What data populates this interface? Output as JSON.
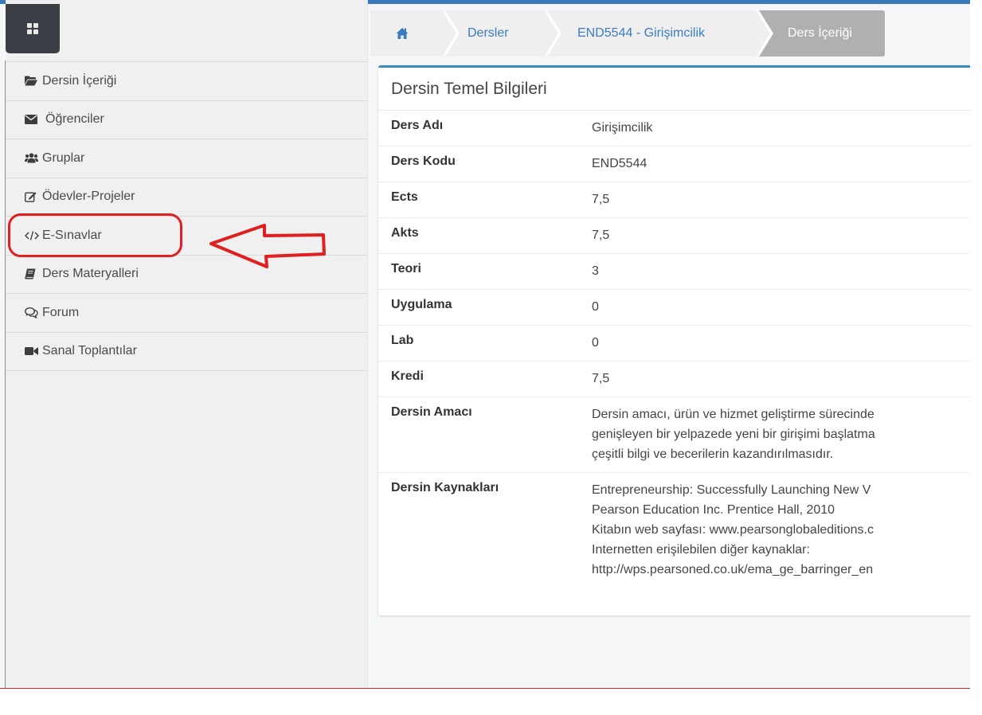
{
  "sidebar": {
    "items": [
      {
        "icon": "folder-open-icon",
        "label": "Dersin İçeriği"
      },
      {
        "icon": "envelope-icon",
        "label": "Öğrenciler"
      },
      {
        "icon": "users-icon",
        "label": "Gruplar"
      },
      {
        "icon": "edit-icon",
        "label": "Ödevler-Projeler"
      },
      {
        "icon": "code-icon",
        "label": "E-Sınavlar"
      },
      {
        "icon": "book-icon",
        "label": "Ders Materyalleri"
      },
      {
        "icon": "comments-icon",
        "label": "Forum"
      },
      {
        "icon": "video-camera-icon",
        "label": "Sanal Toplantılar"
      }
    ]
  },
  "breadcrumb": {
    "home_icon": "home-icon",
    "items": [
      "Dersler",
      "END5544 - Girişimcilik",
      "Ders İçeriği"
    ]
  },
  "panel": {
    "title": "Dersin Temel Bilgileri",
    "rows": [
      {
        "label": "Ders Adı",
        "value": "Girişimcilik"
      },
      {
        "label": "Ders Kodu",
        "value": "END5544"
      },
      {
        "label": "Ects",
        "value": "7,5"
      },
      {
        "label": "Akts",
        "value": "7,5"
      },
      {
        "label": "Teori",
        "value": "3"
      },
      {
        "label": "Uygulama",
        "value": "0"
      },
      {
        "label": "Lab",
        "value": "0"
      },
      {
        "label": "Kredi",
        "value": "7,5"
      }
    ],
    "amac": {
      "label": "Dersin Amacı",
      "lines": [
        "Dersin amacı, ürün ve hizmet geliştirme sürecinde",
        "genişleyen bir yelpazede yeni bir girişimi başlatma",
        "çeşitli bilgi ve becerilerin kazandırılmasıdır."
      ]
    },
    "kaynaklar": {
      "label": "Dersin Kaynakları",
      "lines": [
        "Entrepreneurship: Successfully Launching New V",
        "Pearson Education Inc. Prentice Hall, 2010",
        "Kitabın web sayfası: www.pearsonglobaleditions.c",
        "Internetten erişilebilen diğer kaynaklar:",
        "http://wps.pearsoned.co.uk/ema_ge_barringer_en"
      ]
    }
  },
  "colors": {
    "accent": "#3c8dbc",
    "link": "#3b7bbf",
    "annotation": "#e02020",
    "active_crumb": "#b0b0b0"
  }
}
